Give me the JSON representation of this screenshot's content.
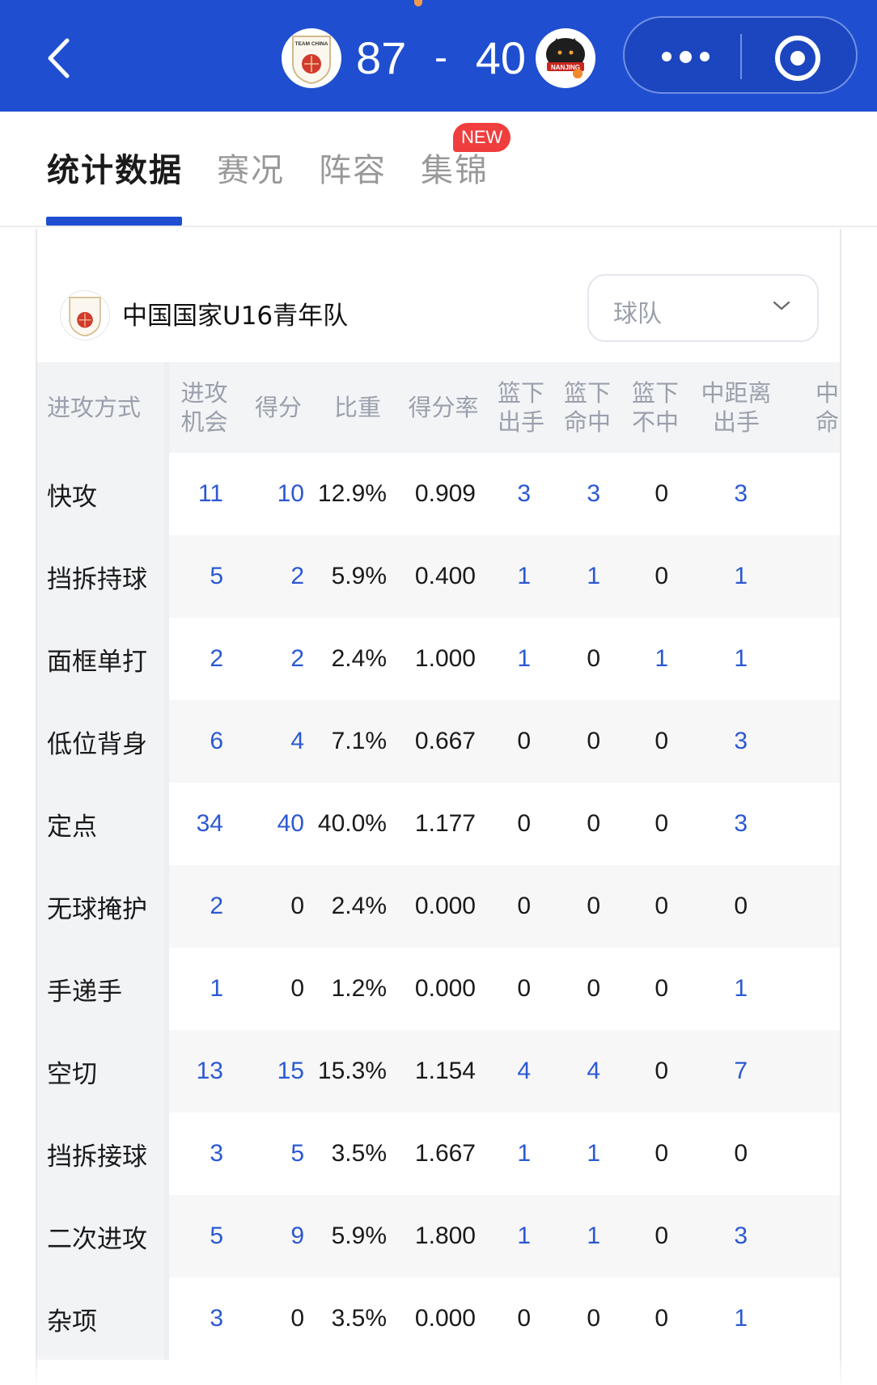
{
  "header": {
    "score_home": "87",
    "score_sep": "-",
    "score_away": "40",
    "home_logo_text": "TEAM CHINA",
    "away_logo_text": "NANJING",
    "colors": {
      "bar": "#1f4fd0",
      "accent_link": "#2b59d3",
      "badge": "#f03e3e"
    },
    "icons": [
      "back-icon",
      "more-icon",
      "target-icon"
    ]
  },
  "tabs": [
    {
      "label": "统计数据",
      "active": true
    },
    {
      "label": "赛况",
      "active": false
    },
    {
      "label": "阵容",
      "active": false
    },
    {
      "label": "集锦",
      "active": false
    }
  ],
  "new_badge": "NEW",
  "team": {
    "name": "中国国家U16青年队",
    "selector": "球队"
  },
  "table": {
    "headers": [
      "进攻方式",
      "进攻\n机会",
      "得分",
      "比重",
      "得分率",
      "篮下\n出手",
      "篮下\n命中",
      "篮下\n不中",
      "中距离\n出手",
      "中距\n命中"
    ],
    "rows": [
      {
        "type": "快攻",
        "chances": "11",
        "points": "10",
        "ratio": "12.9%",
        "rate": "0.909",
        "rim_att": "3",
        "rim_made": "3",
        "rim_miss": "0",
        "mid_att": "3"
      },
      {
        "type": "挡拆持球",
        "chances": "5",
        "points": "2",
        "ratio": "5.9%",
        "rate": "0.400",
        "rim_att": "1",
        "rim_made": "1",
        "rim_miss": "0",
        "mid_att": "1"
      },
      {
        "type": "面框单打",
        "chances": "2",
        "points": "2",
        "ratio": "2.4%",
        "rate": "1.000",
        "rim_att": "1",
        "rim_made": "0",
        "rim_miss": "1",
        "mid_att": "1"
      },
      {
        "type": "低位背身",
        "chances": "6",
        "points": "4",
        "ratio": "7.1%",
        "rate": "0.667",
        "rim_att": "0",
        "rim_made": "0",
        "rim_miss": "0",
        "mid_att": "3"
      },
      {
        "type": "定点",
        "chances": "34",
        "points": "40",
        "ratio": "40.0%",
        "rate": "1.177",
        "rim_att": "0",
        "rim_made": "0",
        "rim_miss": "0",
        "mid_att": "3"
      },
      {
        "type": "无球掩护",
        "chances": "2",
        "points": "0",
        "ratio": "2.4%",
        "rate": "0.000",
        "rim_att": "0",
        "rim_made": "0",
        "rim_miss": "0",
        "mid_att": "0"
      },
      {
        "type": "手递手",
        "chances": "1",
        "points": "0",
        "ratio": "1.2%",
        "rate": "0.000",
        "rim_att": "0",
        "rim_made": "0",
        "rim_miss": "0",
        "mid_att": "1"
      },
      {
        "type": "空切",
        "chances": "13",
        "points": "15",
        "ratio": "15.3%",
        "rate": "1.154",
        "rim_att": "4",
        "rim_made": "4",
        "rim_miss": "0",
        "mid_att": "7"
      },
      {
        "type": "挡拆接球",
        "chances": "3",
        "points": "5",
        "ratio": "3.5%",
        "rate": "1.667",
        "rim_att": "1",
        "rim_made": "1",
        "rim_miss": "0",
        "mid_att": "0"
      },
      {
        "type": "二次进攻",
        "chances": "5",
        "points": "9",
        "ratio": "5.9%",
        "rate": "1.800",
        "rim_att": "1",
        "rim_made": "1",
        "rim_miss": "0",
        "mid_att": "3"
      },
      {
        "type": "杂项",
        "chances": "3",
        "points": "0",
        "ratio": "3.5%",
        "rate": "0.000",
        "rim_att": "0",
        "rim_made": "0",
        "rim_miss": "0",
        "mid_att": "1"
      }
    ]
  }
}
